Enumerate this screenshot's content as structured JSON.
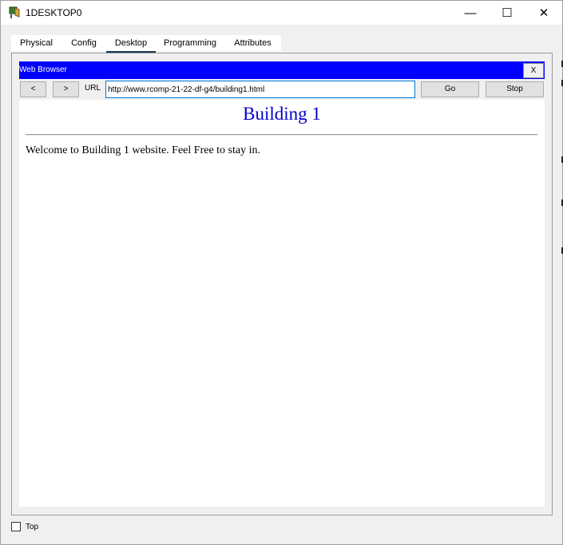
{
  "window": {
    "title": "1DESKTOP0",
    "minimize_glyph": "—",
    "maximize_glyph": "☐",
    "close_glyph": "✕"
  },
  "tabs": [
    {
      "label": "Physical",
      "active": false
    },
    {
      "label": "Config",
      "active": false
    },
    {
      "label": "Desktop",
      "active": true
    },
    {
      "label": "Programming",
      "active": false
    },
    {
      "label": "Attributes",
      "active": false
    }
  ],
  "browser": {
    "title": "Web Browser",
    "close_label": "X",
    "back_label": "<",
    "forward_label": ">",
    "url_label": "URL",
    "url_value": "http://www.rcomp-21-22-df-g4/building1.html",
    "go_label": "Go",
    "stop_label": "Stop"
  },
  "page": {
    "heading": "Building 1",
    "body_text": "Welcome to Building 1 website. Feel Free to stay in."
  },
  "footer": {
    "top_checkbox_label": "Top",
    "top_checked": false
  },
  "colors": {
    "browser_titlebar": "#0000ff",
    "heading": "#0000cd",
    "active_tab_underline": "#1b3651",
    "url_focus_border": "#0078d7"
  }
}
